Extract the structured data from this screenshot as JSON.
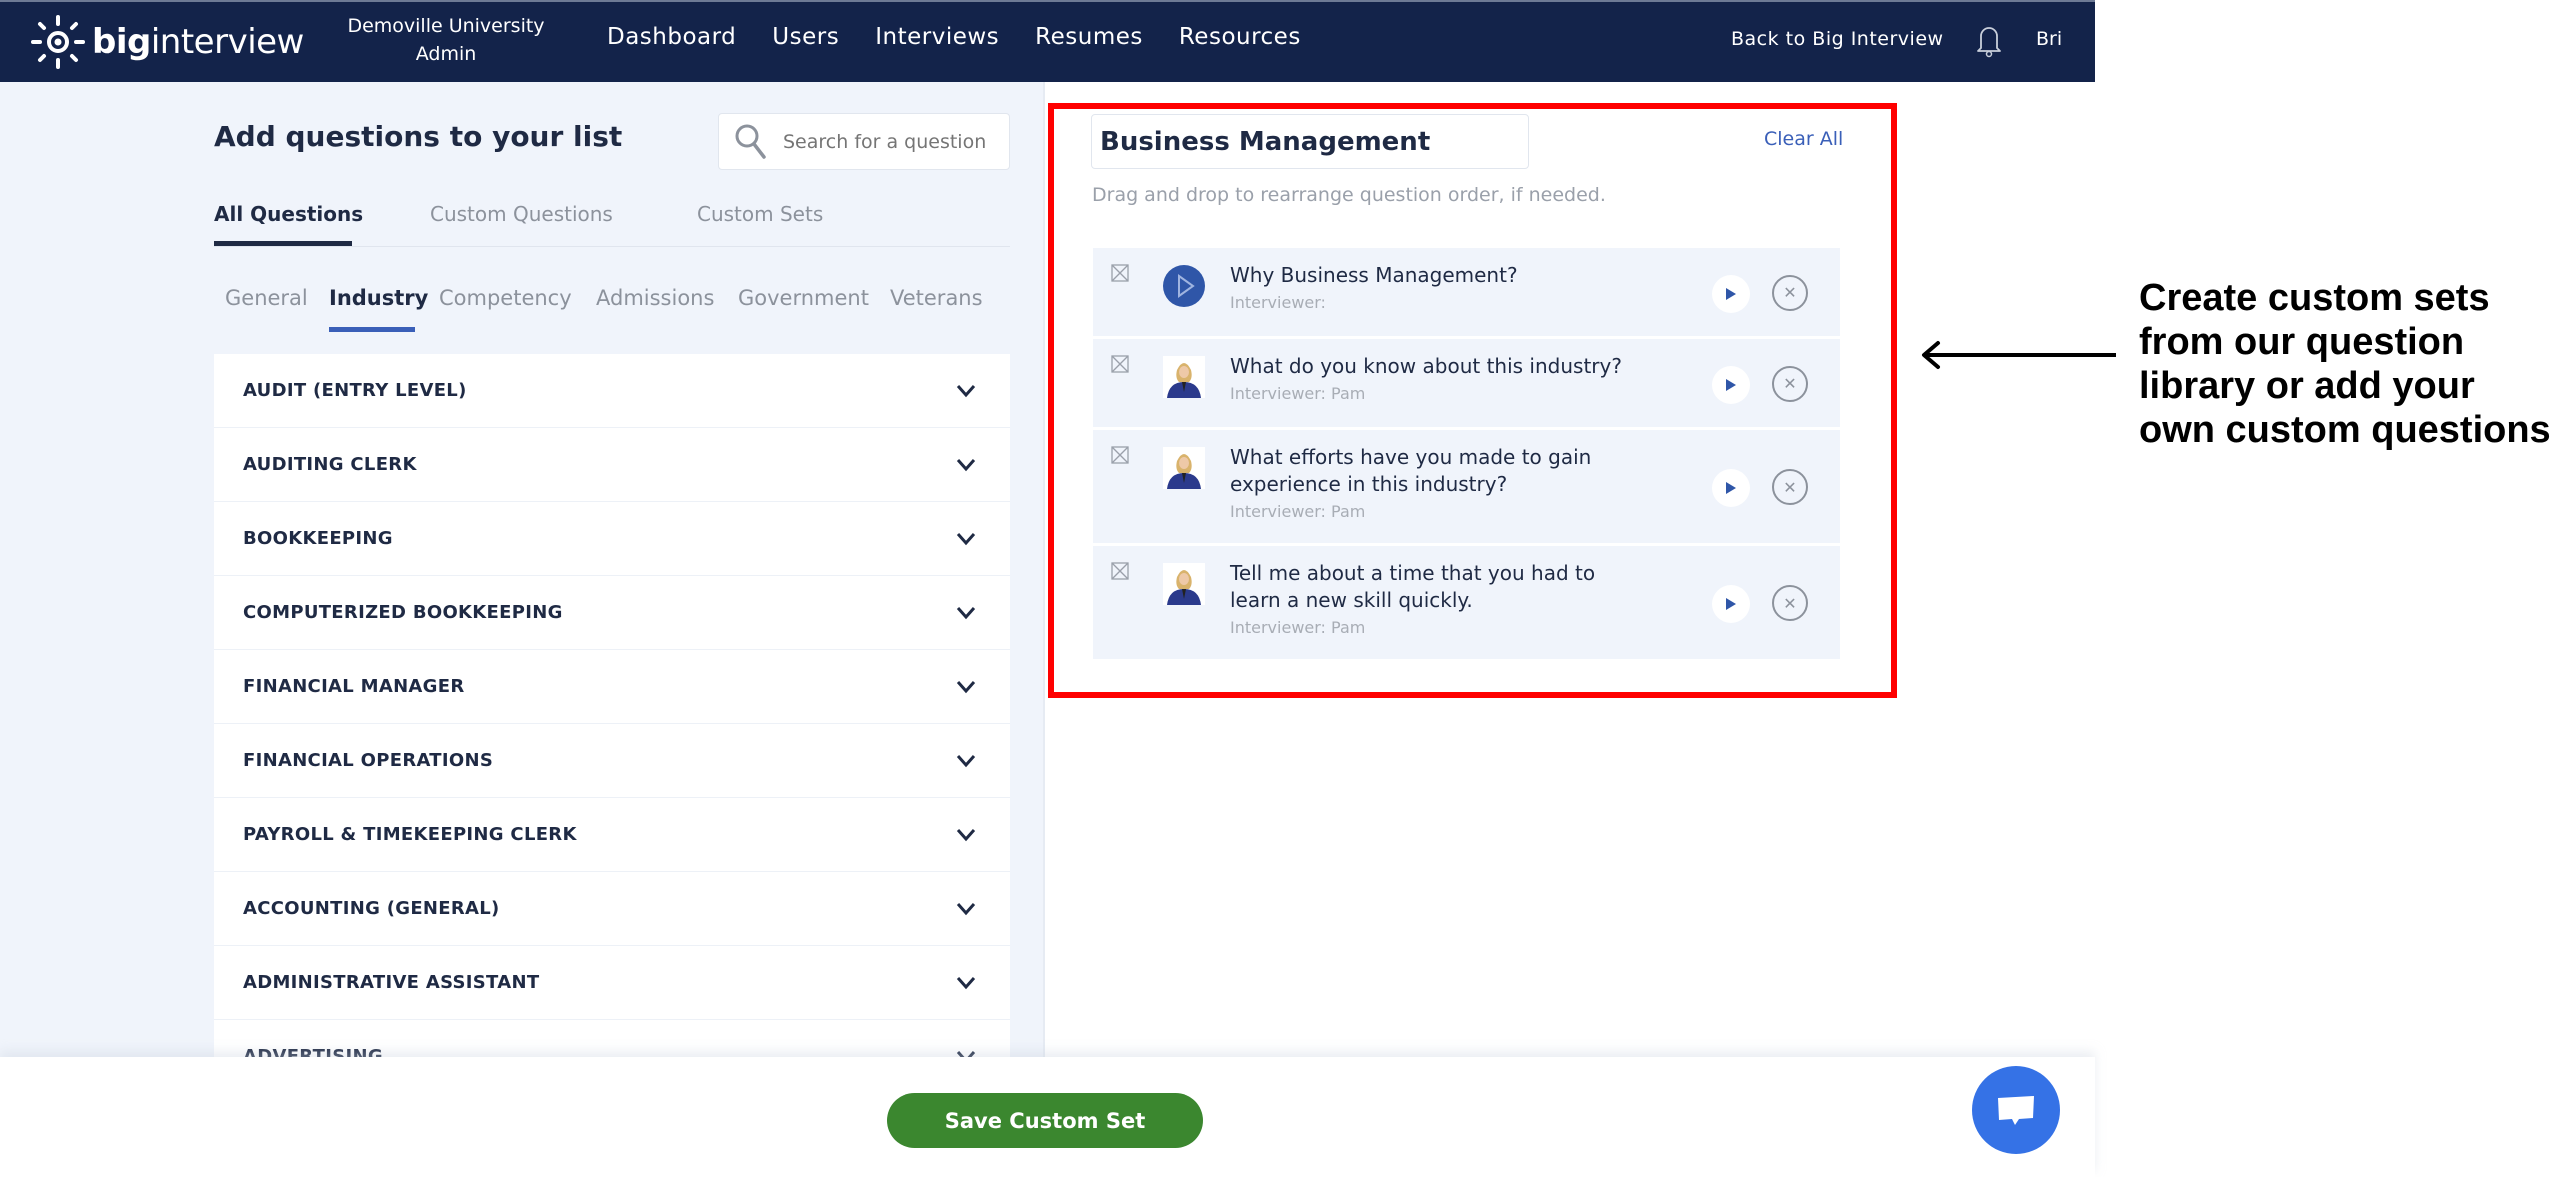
{
  "header": {
    "brand_bold": "big",
    "brand_light": "interview",
    "org_line1": "Demoville University",
    "org_line2": "Admin",
    "nav": [
      "Dashboard",
      "Users",
      "Interviews",
      "Resumes",
      "Resources"
    ],
    "back_link": "Back to Big Interview",
    "bell_icon": "bell-icon",
    "user": "Bri"
  },
  "left": {
    "title": "Add questions to your list",
    "search_placeholder": "Search for a question",
    "tabs": [
      "All Questions",
      "Custom Questions",
      "Custom Sets"
    ],
    "active_tab": "All Questions",
    "subtabs": [
      "General",
      "Industry",
      "Competency",
      "Admissions",
      "Government",
      "Veterans"
    ],
    "active_subtab": "Industry",
    "categories": [
      "AUDIT (ENTRY LEVEL)",
      "AUDITING CLERK",
      "BOOKKEEPING",
      "COMPUTERIZED BOOKKEEPING",
      "FINANCIAL MANAGER",
      "FINANCIAL OPERATIONS",
      "PAYROLL & TIMEKEEPING CLERK",
      "ACCOUNTING (GENERAL)",
      "ADMINISTRATIVE ASSISTANT",
      "ADVERTISING"
    ]
  },
  "right": {
    "set_name": "Business Management",
    "clear_all": "Clear All",
    "hint": "Drag and drop to rearrange question order, if needed.",
    "questions": [
      {
        "text": "Why Business Management?",
        "interviewer": "Interviewer:",
        "avatar": "play-circle"
      },
      {
        "text": "What do you know about this industry?",
        "interviewer": "Interviewer: Pam",
        "avatar": "interviewer-photo"
      },
      {
        "text": "What efforts have you made to gain experience in this industry?",
        "interviewer": "Interviewer: Pam",
        "avatar": "interviewer-photo"
      },
      {
        "text": "Tell me about a time that you had to learn a new skill quickly.",
        "interviewer": "Interviewer: Pam",
        "avatar": "interviewer-photo"
      }
    ]
  },
  "footer": {
    "save_label": "Save Custom Set"
  },
  "annotation": {
    "text": "Create custom sets from our question library or add your own custom questions"
  },
  "colors": {
    "header_bg": "#13234a",
    "accent_blue": "#3a5fb8",
    "save_green": "#3b872f",
    "highlight_red": "#ff0000",
    "chat_blue": "#3572e6"
  }
}
